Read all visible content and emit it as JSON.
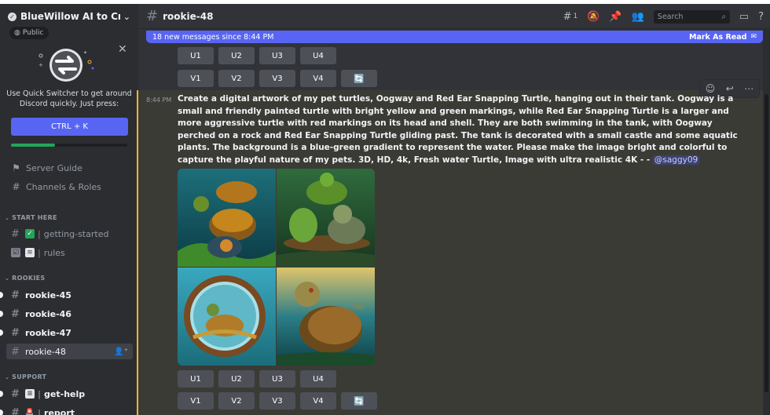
{
  "server": {
    "name": "BlueWillow AI to Crea...",
    "visibility": "Public"
  },
  "quick_switcher": {
    "text": "Use Quick Switcher to get around Discord quickly. Just press:",
    "shortcut": "CTRL + K",
    "progress": 0.38
  },
  "nav": {
    "server_guide": "Server Guide",
    "channels_roles": "Channels & Roles"
  },
  "categories": {
    "start_here": "START HERE",
    "rookies": "ROOKIES",
    "support": "SUPPORT"
  },
  "channels": {
    "getting_started": "getting-started",
    "rules": "rules",
    "rookie_45": "rookie-45",
    "rookie_46": "rookie-46",
    "rookie_47": "rookie-47",
    "rookie_48": "rookie-48",
    "get_help": "get-help",
    "report": "report"
  },
  "header": {
    "channel": "rookie-48",
    "threads_count": "1",
    "search_placeholder": "Search"
  },
  "banner": {
    "text": "18 new messages since 8:44 PM",
    "action": "Mark As Read"
  },
  "buttons": {
    "u": [
      "U1",
      "U2",
      "U3",
      "U4"
    ],
    "v": [
      "V1",
      "V2",
      "V3",
      "V4"
    ]
  },
  "message": {
    "time": "8:44 PM",
    "prompt": "Create a digital artwork of my pet turtles, Oogway and Red Ear Snapping Turtle, hanging out in their tank. Oogway is a small and friendly painted turtle with bright yellow and green markings, while Red Ear Snapping Turtle is a larger and more aggressive turtle with red markings on its head and shell. They are both swimming in the tank, with Oogway perched on a rock and Red Ear Snapping Turtle gliding past. The tank is decorated with a small castle and some aquatic plants. The background is a blue-green gradient to represent the water. Please make the image bright and colorful to capture the playful nature of my pets. 3D, HD, 4k, Fresh water Turtle, Image with ultra realistic 4K - -",
    "mention": "@saggy09"
  },
  "colors": {
    "blurple": "#5865f2",
    "green": "#23a559",
    "highlight_bar": "#f0b232"
  }
}
